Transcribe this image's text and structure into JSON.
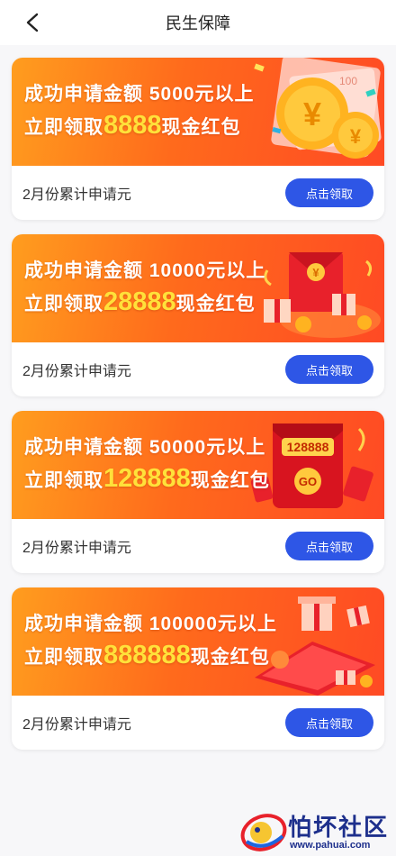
{
  "nav": {
    "title": "民生保障",
    "back_icon": "back-arrow-icon"
  },
  "cards": [
    {
      "line1": "成功申请金额 5000元以上",
      "line2_prefix": "立即领取",
      "amount": "8888",
      "line2_suffix": "现金红包",
      "footer_text": "2月份累计申请元",
      "button_label": "点击领取"
    },
    {
      "line1": "成功申请金额 10000元以上",
      "line2_prefix": "立即领取",
      "amount": "28888",
      "line2_suffix": "现金红包",
      "footer_text": "2月份累计申请元",
      "button_label": "点击领取"
    },
    {
      "line1": "成功申请金额 50000元以上",
      "line2_prefix": "立即领取",
      "amount": "128888",
      "line2_suffix": "现金红包",
      "footer_text": "2月份累计申请元",
      "button_label": "点击领取",
      "envelope_number": "128888",
      "envelope_go": "GO"
    },
    {
      "line1": "成功申请金额 100000元以上",
      "line2_prefix": "立即领取",
      "amount": "888888",
      "line2_suffix": "现金红包",
      "footer_text": "2月份累计申请元",
      "button_label": "点击领取"
    }
  ],
  "coin_symbol": "¥",
  "bill_number": "100",
  "watermark": {
    "title": "怕坏社区",
    "url": "www.pahuai.com"
  },
  "colors": {
    "accent_button": "#2e56e6",
    "banner_orange": "#ff6a1c",
    "amount_yellow": "#ffe13a",
    "watermark_blue": "#1d2f8c"
  }
}
